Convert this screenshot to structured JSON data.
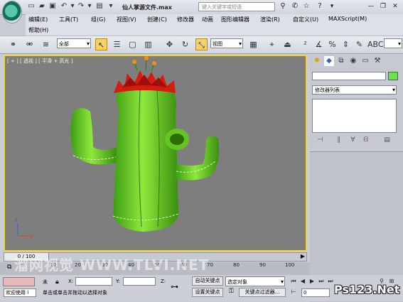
{
  "titlebar": {
    "document_title": "仙人掌源文件.max",
    "search_placeholder": "键入关键字或短语"
  },
  "menus": [
    "编辑(E)",
    "工具(T)",
    "组(G)",
    "视图(V)",
    "创建(C)",
    "修改器",
    "动画",
    "图形编辑器",
    "渲染(R)",
    "自定义(U)",
    "MAXScript(M)",
    "帮助(H)"
  ],
  "toolbar": {
    "selection_filter": "全部",
    "reference_coord": "视图"
  },
  "viewport": {
    "label": "[ + ] [ 透视 ] [ 平滑 + 高光 ]"
  },
  "command_panel": {
    "modifier_list": "修改器列表",
    "object_color": "#6ee24e"
  },
  "timeline": {
    "frame_counter": "0 / 100",
    "ruler_ticks": [
      "0",
      "10",
      "20",
      "30",
      "40",
      "50",
      "60",
      "70",
      "80",
      "90",
      "100"
    ]
  },
  "status": {
    "welcome": "欢迎使用 l",
    "selection_state": "未",
    "prompt": "单击或单击并拖动以选择对象",
    "x_label": "X:",
    "y_label": "Y:",
    "z_label": "Z:",
    "auto_key": "自动关键点",
    "set_key": "设置关键点",
    "selected_object": "选定对象",
    "key_filters": "关键点过滤器...",
    "current_frame": "0"
  },
  "watermarks": {
    "center": "溜网视觉 WWW.TLVI.NET",
    "corner": "Ps123.Net"
  }
}
